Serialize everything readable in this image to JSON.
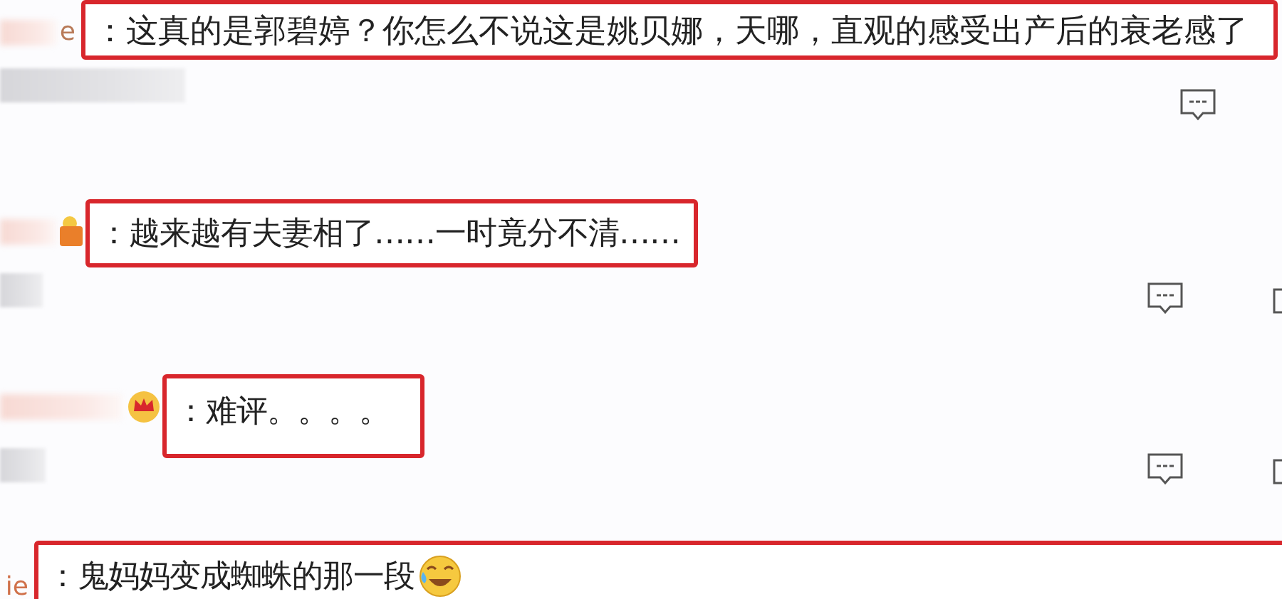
{
  "comments": [
    {
      "user": "e",
      "kind": "plain",
      "text": "：这真的是郭碧婷？你怎么不说这是姚贝娜，天哪，直观的感受出产后的衰老感了",
      "reply_icon": true
    },
    {
      "kind": "medal",
      "text": "：越来越有夫妻相了……一时竟分不清……",
      "reply_icon": true
    },
    {
      "kind": "crown",
      "text": "：难评。。。。",
      "reply_icon": true
    },
    {
      "user": "ie",
      "kind": "plain",
      "text": "：鬼妈妈变成蜘蛛的那一段",
      "emoji": true,
      "reply_icon": false
    }
  ]
}
